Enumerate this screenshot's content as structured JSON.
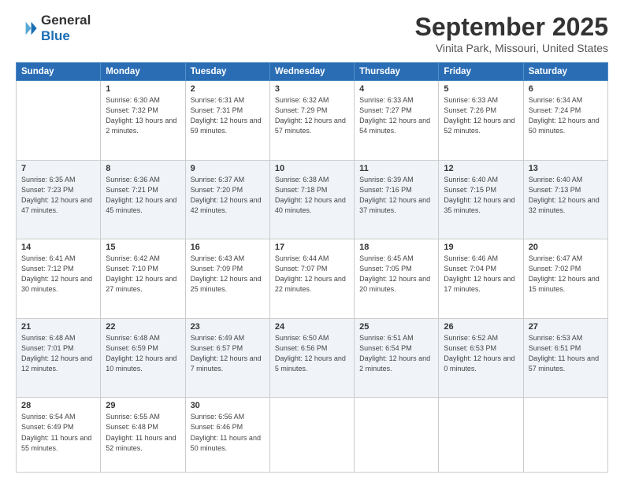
{
  "logo": {
    "line1": "General",
    "line2": "Blue"
  },
  "title": "September 2025",
  "location": "Vinita Park, Missouri, United States",
  "weekdays": [
    "Sunday",
    "Monday",
    "Tuesday",
    "Wednesday",
    "Thursday",
    "Friday",
    "Saturday"
  ],
  "weeks": [
    [
      {
        "day": "",
        "empty": true
      },
      {
        "day": "1",
        "sunrise": "6:30 AM",
        "sunset": "7:32 PM",
        "daylight": "13 hours and 2 minutes."
      },
      {
        "day": "2",
        "sunrise": "6:31 AM",
        "sunset": "7:31 PM",
        "daylight": "12 hours and 59 minutes."
      },
      {
        "day": "3",
        "sunrise": "6:32 AM",
        "sunset": "7:29 PM",
        "daylight": "12 hours and 57 minutes."
      },
      {
        "day": "4",
        "sunrise": "6:33 AM",
        "sunset": "7:27 PM",
        "daylight": "12 hours and 54 minutes."
      },
      {
        "day": "5",
        "sunrise": "6:33 AM",
        "sunset": "7:26 PM",
        "daylight": "12 hours and 52 minutes."
      },
      {
        "day": "6",
        "sunrise": "6:34 AM",
        "sunset": "7:24 PM",
        "daylight": "12 hours and 50 minutes."
      }
    ],
    [
      {
        "day": "7",
        "sunrise": "6:35 AM",
        "sunset": "7:23 PM",
        "daylight": "12 hours and 47 minutes."
      },
      {
        "day": "8",
        "sunrise": "6:36 AM",
        "sunset": "7:21 PM",
        "daylight": "12 hours and 45 minutes."
      },
      {
        "day": "9",
        "sunrise": "6:37 AM",
        "sunset": "7:20 PM",
        "daylight": "12 hours and 42 minutes."
      },
      {
        "day": "10",
        "sunrise": "6:38 AM",
        "sunset": "7:18 PM",
        "daylight": "12 hours and 40 minutes."
      },
      {
        "day": "11",
        "sunrise": "6:39 AM",
        "sunset": "7:16 PM",
        "daylight": "12 hours and 37 minutes."
      },
      {
        "day": "12",
        "sunrise": "6:40 AM",
        "sunset": "7:15 PM",
        "daylight": "12 hours and 35 minutes."
      },
      {
        "day": "13",
        "sunrise": "6:40 AM",
        "sunset": "7:13 PM",
        "daylight": "12 hours and 32 minutes."
      }
    ],
    [
      {
        "day": "14",
        "sunrise": "6:41 AM",
        "sunset": "7:12 PM",
        "daylight": "12 hours and 30 minutes."
      },
      {
        "day": "15",
        "sunrise": "6:42 AM",
        "sunset": "7:10 PM",
        "daylight": "12 hours and 27 minutes."
      },
      {
        "day": "16",
        "sunrise": "6:43 AM",
        "sunset": "7:09 PM",
        "daylight": "12 hours and 25 minutes."
      },
      {
        "day": "17",
        "sunrise": "6:44 AM",
        "sunset": "7:07 PM",
        "daylight": "12 hours and 22 minutes."
      },
      {
        "day": "18",
        "sunrise": "6:45 AM",
        "sunset": "7:05 PM",
        "daylight": "12 hours and 20 minutes."
      },
      {
        "day": "19",
        "sunrise": "6:46 AM",
        "sunset": "7:04 PM",
        "daylight": "12 hours and 17 minutes."
      },
      {
        "day": "20",
        "sunrise": "6:47 AM",
        "sunset": "7:02 PM",
        "daylight": "12 hours and 15 minutes."
      }
    ],
    [
      {
        "day": "21",
        "sunrise": "6:48 AM",
        "sunset": "7:01 PM",
        "daylight": "12 hours and 12 minutes."
      },
      {
        "day": "22",
        "sunrise": "6:48 AM",
        "sunset": "6:59 PM",
        "daylight": "12 hours and 10 minutes."
      },
      {
        "day": "23",
        "sunrise": "6:49 AM",
        "sunset": "6:57 PM",
        "daylight": "12 hours and 7 minutes."
      },
      {
        "day": "24",
        "sunrise": "6:50 AM",
        "sunset": "6:56 PM",
        "daylight": "12 hours and 5 minutes."
      },
      {
        "day": "25",
        "sunrise": "6:51 AM",
        "sunset": "6:54 PM",
        "daylight": "12 hours and 2 minutes."
      },
      {
        "day": "26",
        "sunrise": "6:52 AM",
        "sunset": "6:53 PM",
        "daylight": "12 hours and 0 minutes."
      },
      {
        "day": "27",
        "sunrise": "6:53 AM",
        "sunset": "6:51 PM",
        "daylight": "11 hours and 57 minutes."
      }
    ],
    [
      {
        "day": "28",
        "sunrise": "6:54 AM",
        "sunset": "6:49 PM",
        "daylight": "11 hours and 55 minutes."
      },
      {
        "day": "29",
        "sunrise": "6:55 AM",
        "sunset": "6:48 PM",
        "daylight": "11 hours and 52 minutes."
      },
      {
        "day": "30",
        "sunrise": "6:56 AM",
        "sunset": "6:46 PM",
        "daylight": "11 hours and 50 minutes."
      },
      {
        "day": "",
        "empty": true
      },
      {
        "day": "",
        "empty": true
      },
      {
        "day": "",
        "empty": true
      },
      {
        "day": "",
        "empty": true
      }
    ]
  ]
}
